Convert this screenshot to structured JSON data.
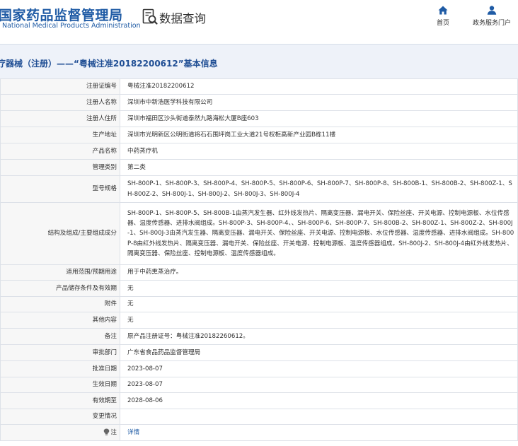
{
  "header": {
    "logo_cn": "国家药品监督管理局",
    "logo_en": "National Medical Products Administration",
    "section_title": "数据查询",
    "nav": {
      "home": "首页",
      "portal": "政务服务门户"
    }
  },
  "title": "疗器械（注册）——“粤械注准20182200612”基本信息",
  "rows": [
    {
      "label": "注册证编号",
      "value": "粤械注准20182200612"
    },
    {
      "label": "注册人名称",
      "value": "深圳市中新浩医学科技有限公司"
    },
    {
      "label": "注册人住所",
      "value": "深圳市福田区沙头街道泰然九路海松大厦B座603"
    },
    {
      "label": "生产地址",
      "value": "深圳市光明新区公明街道将石石围坪岗工业大道21号权柜高新产业园B栋11楼"
    },
    {
      "label": "产品名称",
      "value": "中药蒸疗机"
    },
    {
      "label": "管理类别",
      "value": "第二类"
    },
    {
      "label": "型号规格",
      "value": "SH-800P-1、SH-800P-3、SH-800P-4、SH-800P-5、SH-800P-6、SH-800P-7、SH-800P-8、SH-800B-1、SH-800B-2、SH-800Z-1、SH-800Z-2、SH-800J-1、SH-800J-2、SH-800J-3、SH-800J-4"
    },
    {
      "label": "结构及组成/主要组成成分",
      "value": "SH-800P-1、SH-800P-5、SH-800B-1由蒸汽发生器、红外线发热片、隔离变压器、漏电开关、保险丝座、开关电源、控制电源板、水位传感器、温度传感器、进排水阀组成。SH-800P-3、SH-800P-4、、SH-800P-6、SH-800P-7、SH-800B-2、SH-800Z-1、SH-800Z-2、SH-800J-1、SH-800J-3由蒸汽发生器、隔离变压器、漏电开关、保险丝座、开关电源、控制电源板、水位传感器、温度传感器、进排水阀组成。SH-800P-8由红外线发热片、隔离变压器、漏电开关、保险丝座、开关电源、控制电源板、温度传感器组成。SH-800J-2、SH-800J-4由红外线发热片、隔离变压器、保险丝座、控制电源板、温度传感器组成。"
    },
    {
      "label": "适用范围/预期用途",
      "value": "用于中药熏蒸治疗。"
    },
    {
      "label": "产品储存条件及有效期",
      "value": "无"
    },
    {
      "label": "附件",
      "value": "无"
    },
    {
      "label": "其他内容",
      "value": "无"
    },
    {
      "label": "备注",
      "value": "原产品注册证号：粤械注准20182260612。"
    },
    {
      "label": "审批部门",
      "value": "广东省食品药品监督管理局"
    },
    {
      "label": "批准日期",
      "value": "2023-08-07"
    },
    {
      "label": "生效日期",
      "value": "2023-08-07"
    },
    {
      "label": "有效期至",
      "value": "2028-08-06"
    },
    {
      "label": "变更情况",
      "value": ""
    },
    {
      "label": "注",
      "value": "详情"
    }
  ]
}
